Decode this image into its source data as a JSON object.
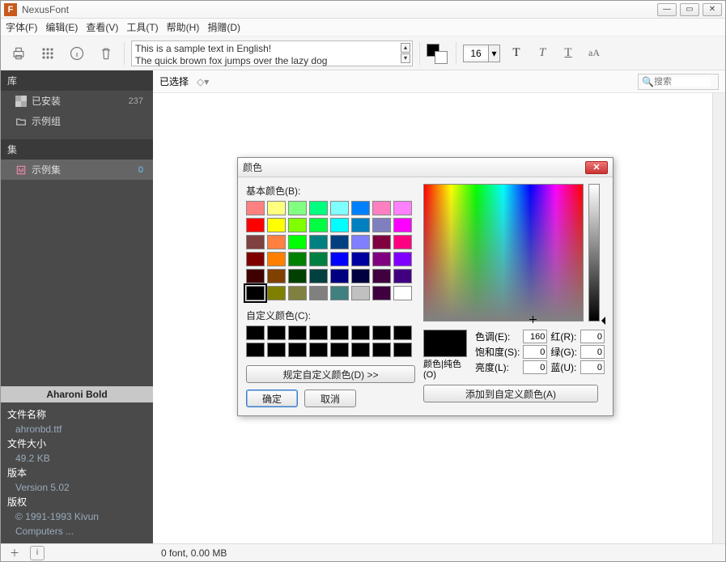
{
  "app": {
    "title": "NexusFont",
    "logo_letter": "F"
  },
  "menu": [
    "字体(F)",
    "编辑(E)",
    "查看(V)",
    "工具(T)",
    "帮助(H)",
    "捐赠(D)"
  ],
  "toolbar": {
    "sample_line1": "This is a sample text in English!",
    "sample_line2": "The quick brown fox jumps over the lazy dog",
    "fg_color": "#000000",
    "bg_color": "#ffffff",
    "font_size": "16"
  },
  "sidebar": {
    "lib_head": "库",
    "lib_items": [
      {
        "label": "已安装",
        "count": "237"
      },
      {
        "label": "示例组",
        "count": ""
      }
    ],
    "set_head": "集",
    "set_items": [
      {
        "label": "示例集",
        "count": "0"
      }
    ],
    "font_name": "Aharoni Bold",
    "info": {
      "filename_lab": "文件名称",
      "filename": "ahronbd.ttf",
      "filesize_lab": "文件大小",
      "filesize": "49.2 KB",
      "version_lab": "版本",
      "version": "Version 5.02",
      "copyright_lab": "版权",
      "copyright": "© 1991-1993 Kivun Computers ..."
    }
  },
  "subbar": {
    "selected": "已选择",
    "search_ph": "搜索"
  },
  "status": {
    "text": "0 font, 0.00 MB"
  },
  "dialog": {
    "title": "颜色",
    "basic_label": "基本颜色(B):",
    "custom_label": "自定义颜色(C):",
    "define_btn": "规定自定义颜色(D) >>",
    "ok": "确定",
    "cancel": "取消",
    "solid_label": "颜色|纯色(O)",
    "hue_lab": "色调(E):",
    "sat_lab": "饱和度(S):",
    "lum_lab": "亮度(L):",
    "red_lab": "红(R):",
    "green_lab": "绿(G):",
    "blue_lab": "蓝(U):",
    "hue": "160",
    "sat": "0",
    "lum": "0",
    "red": "0",
    "green": "0",
    "blue": "0",
    "add_btn": "添加到自定义颜色(A)",
    "basic_colors": [
      "#ff8080",
      "#ffff80",
      "#80ff80",
      "#00ff80",
      "#80ffff",
      "#0080ff",
      "#ff80c0",
      "#ff80ff",
      "#ff0000",
      "#ffff00",
      "#80ff00",
      "#00ff40",
      "#00ffff",
      "#0080c0",
      "#8080c0",
      "#ff00ff",
      "#804040",
      "#ff8040",
      "#00ff00",
      "#008080",
      "#004080",
      "#8080ff",
      "#800040",
      "#ff0080",
      "#800000",
      "#ff8000",
      "#008000",
      "#008040",
      "#0000ff",
      "#0000a0",
      "#800080",
      "#8000ff",
      "#400000",
      "#804000",
      "#004000",
      "#004040",
      "#000080",
      "#000040",
      "#400040",
      "#400080",
      "#000000",
      "#808000",
      "#808040",
      "#808080",
      "#408080",
      "#c0c0c0",
      "#400040",
      "#ffffff"
    ]
  }
}
